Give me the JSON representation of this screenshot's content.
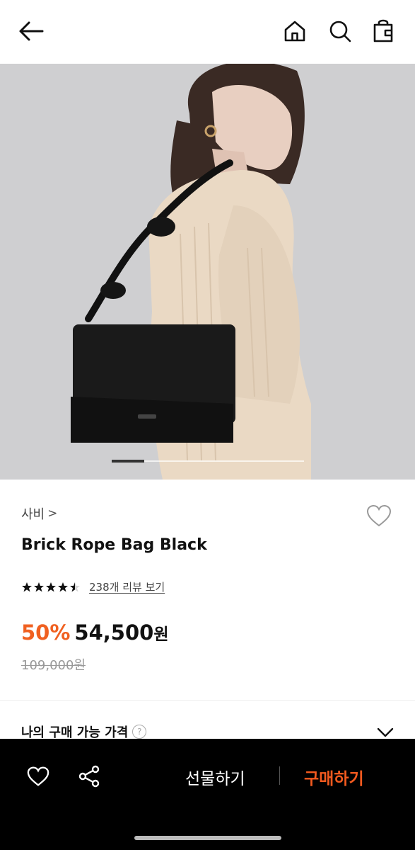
{
  "header": {
    "icons": [
      "back-arrow-icon",
      "home-icon",
      "search-icon",
      "shopping-bag-icon"
    ]
  },
  "gallery": {
    "image_alt": "brick-rope-bag-model-photo",
    "current_slide_fraction": 0.17
  },
  "product": {
    "brand": "사비",
    "brand_chevron": ">",
    "name": "Brick Rope Bag Black",
    "rating": 4.5,
    "review_link": "238개 리뷰 보기",
    "discount": "50%",
    "price": "54,500",
    "price_unit": "원",
    "original_price": "109,000원"
  },
  "purchase_price": {
    "label": "나의 구매 가능 가격",
    "help_glyph": "?"
  },
  "bottom_bar": {
    "gift_label": "선물하기",
    "buy_label": "구매하기"
  },
  "colors": {
    "accent": "#f25a1f",
    "discount": "#f06020",
    "bottom_bar_bg": "#000000"
  }
}
